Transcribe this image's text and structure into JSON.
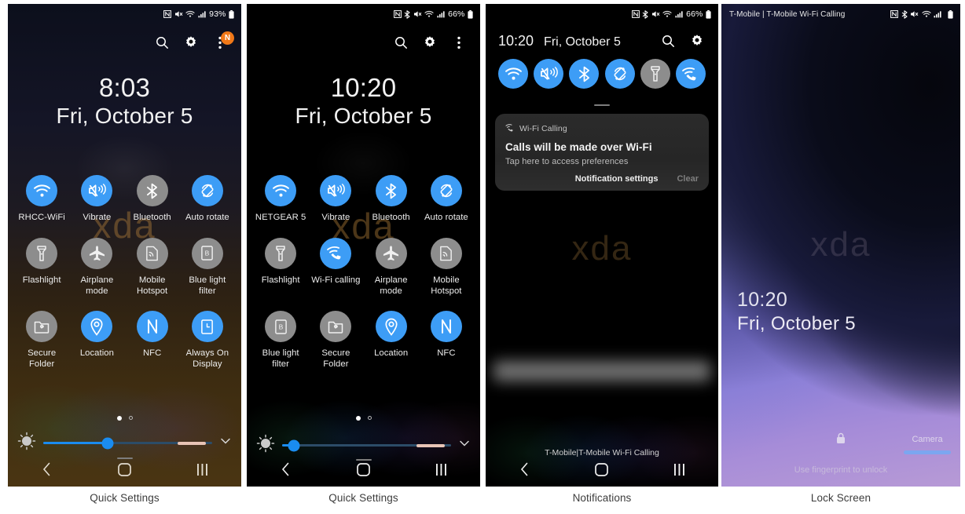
{
  "figure": {
    "captions": [
      "Quick Settings",
      "Quick Settings",
      "Notifications",
      "Lock Screen"
    ]
  },
  "colors": {
    "tile_on": "#3d9df6",
    "tile_off": "#8d8d8d",
    "badge": "#f07818",
    "slider_fill": "#1a8cf0",
    "auto_brightness": "#e8c4b6",
    "camera_bar": "#7ca6f0",
    "watermark": "#be873c"
  },
  "panel1": {
    "status_bar": {
      "left_text": "",
      "icons": [
        "nfc-icon",
        "mute-icon",
        "wifi-icon",
        "signal-icon"
      ],
      "battery_percent": "93%"
    },
    "header": {
      "search_label": "search-icon",
      "settings_label": "gear-icon",
      "more_label": "more-vert-icon",
      "badge_text": "N"
    },
    "clock": {
      "time": "8:03",
      "date": "Fri, October 5"
    },
    "tiles": [
      {
        "label": "RHCC-WiFi",
        "icon": "wifi-icon",
        "state": "on"
      },
      {
        "label": "Vibrate",
        "icon": "vibrate-icon",
        "state": "on"
      },
      {
        "label": "Bluetooth",
        "icon": "bluetooth-icon",
        "state": "off"
      },
      {
        "label": "Auto rotate",
        "icon": "auto-rotate-icon",
        "state": "on"
      },
      {
        "label": "Flashlight",
        "icon": "flashlight-icon",
        "state": "off"
      },
      {
        "label": "Airplane mode",
        "icon": "airplane-icon",
        "state": "off"
      },
      {
        "label": "Mobile Hotspot",
        "icon": "hotspot-icon",
        "state": "off"
      },
      {
        "label": "Blue light filter",
        "icon": "blue-light-icon",
        "state": "off"
      },
      {
        "label": "Secure Folder",
        "icon": "secure-folder-icon",
        "state": "off"
      },
      {
        "label": "Location",
        "icon": "location-icon",
        "state": "on"
      },
      {
        "label": "NFC",
        "icon": "nfc-icon",
        "state": "on"
      },
      {
        "label": "Always On Display",
        "icon": "always-on-display-icon",
        "state": "on"
      }
    ],
    "page_dots": {
      "count": 2,
      "active_index": 0
    },
    "brightness": {
      "value_percent": 38,
      "auto_marker_percent": 88
    },
    "watermark": "xda",
    "navbar": [
      "back-icon",
      "home-icon",
      "recents-icon"
    ]
  },
  "panel2": {
    "status_bar": {
      "left_text": "",
      "icons": [
        "nfc-icon",
        "bluetooth-icon",
        "mute-icon",
        "wifi-icon",
        "signal-icon"
      ],
      "battery_percent": "66%"
    },
    "header": {
      "search_label": "search-icon",
      "settings_label": "gear-icon",
      "more_label": "more-vert-icon"
    },
    "clock": {
      "time": "10:20",
      "date": "Fri, October 5"
    },
    "tiles": [
      {
        "label": "NETGEAR 5",
        "icon": "wifi-icon",
        "state": "on"
      },
      {
        "label": "Vibrate",
        "icon": "vibrate-icon",
        "state": "on"
      },
      {
        "label": "Bluetooth",
        "icon": "bluetooth-icon",
        "state": "on"
      },
      {
        "label": "Auto rotate",
        "icon": "auto-rotate-icon",
        "state": "on"
      },
      {
        "label": "Flashlight",
        "icon": "flashlight-icon",
        "state": "off"
      },
      {
        "label": "Wi-Fi calling",
        "icon": "wifi-calling-icon",
        "state": "on"
      },
      {
        "label": "Airplane mode",
        "icon": "airplane-icon",
        "state": "off"
      },
      {
        "label": "Mobile Hotspot",
        "icon": "hotspot-icon",
        "state": "off"
      },
      {
        "label": "Blue light filter",
        "icon": "blue-light-icon",
        "state": "off"
      },
      {
        "label": "Secure Folder",
        "icon": "secure-folder-icon",
        "state": "off"
      },
      {
        "label": "Location",
        "icon": "location-icon",
        "state": "on"
      },
      {
        "label": "NFC",
        "icon": "nfc-icon",
        "state": "on"
      }
    ],
    "page_dots": {
      "count": 2,
      "active_index": 0
    },
    "brightness": {
      "value_percent": 7,
      "auto_marker_percent": 88
    },
    "watermark": "xda",
    "navbar": [
      "back-icon",
      "home-icon",
      "recents-icon"
    ]
  },
  "panel3": {
    "status_bar": {
      "left_text": "",
      "icons": [
        "nfc-icon",
        "bluetooth-icon",
        "mute-icon",
        "wifi-icon",
        "signal-icon"
      ],
      "battery_percent": "66%"
    },
    "header": {
      "time": "10:20",
      "date": "Fri, October 5",
      "search_label": "search-icon",
      "settings_label": "gear-icon"
    },
    "tiles": [
      {
        "icon": "wifi-icon",
        "state": "on"
      },
      {
        "icon": "vibrate-icon",
        "state": "on"
      },
      {
        "icon": "bluetooth-icon",
        "state": "on"
      },
      {
        "icon": "auto-rotate-icon",
        "state": "on"
      },
      {
        "icon": "flashlight-icon",
        "state": "off"
      },
      {
        "icon": "wifi-calling-icon",
        "state": "on"
      }
    ],
    "notification": {
      "app_name": "Wi-Fi Calling",
      "app_icon": "wifi-calling-icon",
      "title": "Calls will be made over Wi-Fi",
      "subtitle": "Tap here to access preferences",
      "action_settings": "Notification settings",
      "action_clear": "Clear"
    },
    "carrier_text": "T-Mobile|T-Mobile Wi-Fi Calling",
    "watermark": "xda",
    "navbar": [
      "back-icon",
      "home-icon",
      "recents-icon"
    ]
  },
  "panel4": {
    "status_bar": {
      "left_text": "T-Mobile | T-Mobile Wi-Fi Calling",
      "icons": [
        "nfc-icon",
        "bluetooth-icon",
        "mute-icon",
        "wifi-icon",
        "signal-icon"
      ],
      "battery_percent": ""
    },
    "clock": {
      "time": "10:20",
      "date": "Fri, October 5"
    },
    "lock_icon": "lock-icon",
    "hint_text": "Use fingerprint to unlock",
    "camera_label": "Camera",
    "watermark": "xda"
  }
}
